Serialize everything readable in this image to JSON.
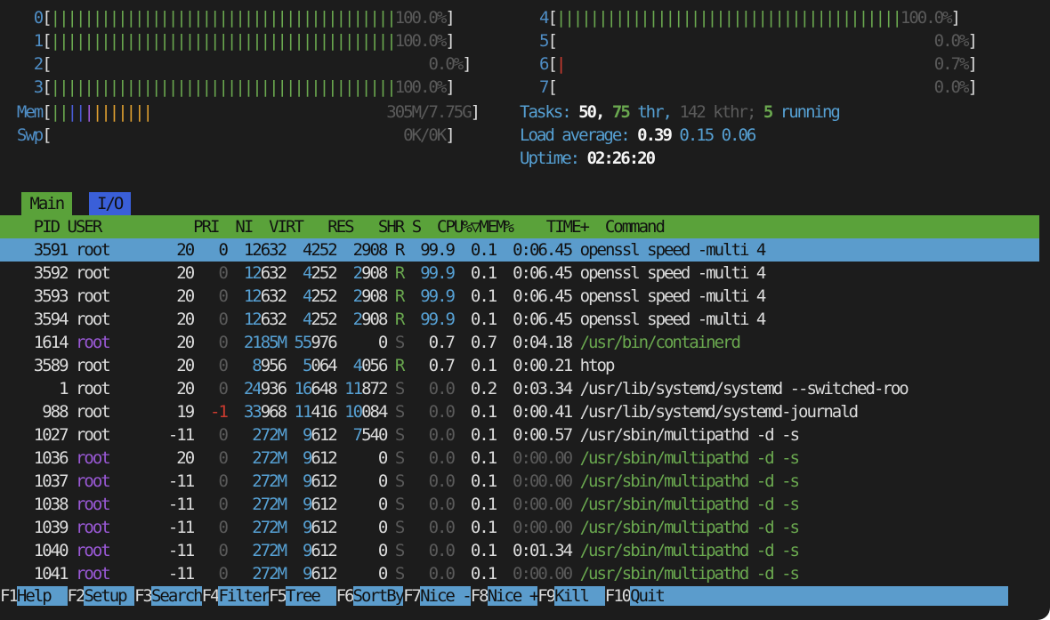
{
  "cpu_meters": [
    {
      "id": "0",
      "pct": "100.0%",
      "level": 1.0
    },
    {
      "id": "1",
      "pct": "100.0%",
      "level": 1.0
    },
    {
      "id": "2",
      "pct": "0.0%",
      "level": 0.0
    },
    {
      "id": "3",
      "pct": "100.0%",
      "level": 1.0
    },
    {
      "id": "4",
      "pct": "100.0%",
      "level": 1.0
    },
    {
      "id": "5",
      "pct": "0.0%",
      "level": 0.0
    },
    {
      "id": "6",
      "pct": "0.7%",
      "level": 0.007
    },
    {
      "id": "7",
      "pct": "0.0%",
      "level": 0.0
    }
  ],
  "mem": {
    "label": "Mem",
    "value": "305M/7.75G"
  },
  "swp": {
    "label": "Swp",
    "value": "0K/0K"
  },
  "tasks": {
    "label": "Tasks:",
    "count": "50,",
    "thr": "75",
    "thr_label": "thr,",
    "kthr": "142 kthr;",
    "running": "5",
    "running_label": "running"
  },
  "load": {
    "label": "Load average:",
    "one": "0.39",
    "five": "0.15",
    "fifteen": "0.06"
  },
  "uptime": {
    "label": "Uptime:",
    "value": "02:26:20"
  },
  "tabs": {
    "main": "Main",
    "io": "I/O"
  },
  "columns": {
    "pid": "PID",
    "user": "USER",
    "pri": "PRI",
    "ni": "NI",
    "virt": "VIRT",
    "res": "RES",
    "shr": "SHR",
    "s": "S",
    "cpu": "CPU%▽",
    "mem": "MEM%",
    "time": "TIME+",
    "command": "Command"
  },
  "processes": [
    {
      "pid": "3591",
      "user": "root",
      "pri": "20",
      "ni": "0",
      "virt": "12632",
      "res": "4252",
      "shr": "2908",
      "s": "R",
      "cpu": "99.9",
      "mem": "0.1",
      "time": "0:06.45",
      "cmd": "openssl speed -multi 4"
    },
    {
      "pid": "3592",
      "user": "root",
      "pri": "20",
      "ni": "0",
      "virt": "12632",
      "res": "4252",
      "shr": "2908",
      "s": "R",
      "cpu": "99.9",
      "mem": "0.1",
      "time": "0:06.45",
      "cmd": "openssl speed -multi 4"
    },
    {
      "pid": "3593",
      "user": "root",
      "pri": "20",
      "ni": "0",
      "virt": "12632",
      "res": "4252",
      "shr": "2908",
      "s": "R",
      "cpu": "99.9",
      "mem": "0.1",
      "time": "0:06.45",
      "cmd": "openssl speed -multi 4"
    },
    {
      "pid": "3594",
      "user": "root",
      "pri": "20",
      "ni": "0",
      "virt": "12632",
      "res": "4252",
      "shr": "2908",
      "s": "R",
      "cpu": "99.9",
      "mem": "0.1",
      "time": "0:06.45",
      "cmd": "openssl speed -multi 4"
    },
    {
      "pid": "1614",
      "user": "root",
      "pri": "20",
      "ni": "0",
      "virt": "2185M",
      "res": "55976",
      "shr": "0",
      "s": "S",
      "cpu": "0.7",
      "mem": "0.7",
      "time": "0:04.18",
      "cmd": "/usr/bin/containerd"
    },
    {
      "pid": "3589",
      "user": "root",
      "pri": "20",
      "ni": "0",
      "virt": "8956",
      "res": "5064",
      "shr": "4056",
      "s": "R",
      "cpu": "0.7",
      "mem": "0.1",
      "time": "0:00.21",
      "cmd": "htop"
    },
    {
      "pid": "1",
      "user": "root",
      "pri": "20",
      "ni": "0",
      "virt": "24936",
      "res": "16648",
      "shr": "11872",
      "s": "S",
      "cpu": "0.0",
      "mem": "0.2",
      "time": "0:03.34",
      "cmd": "/usr/lib/systemd/systemd --switched-roo"
    },
    {
      "pid": "988",
      "user": "root",
      "pri": "19",
      "ni": "-1",
      "virt": "33968",
      "res": "11416",
      "shr": "10084",
      "s": "S",
      "cpu": "0.0",
      "mem": "0.1",
      "time": "0:00.41",
      "cmd": "/usr/lib/systemd/systemd-journald"
    },
    {
      "pid": "1027",
      "user": "root",
      "pri": "-11",
      "ni": "0",
      "virt": "272M",
      "res": "9612",
      "shr": "7540",
      "s": "S",
      "cpu": "0.0",
      "mem": "0.1",
      "time": "0:00.57",
      "cmd": "/usr/sbin/multipathd -d -s"
    },
    {
      "pid": "1036",
      "user": "root",
      "pri": "20",
      "ni": "0",
      "virt": "272M",
      "res": "9612",
      "shr": "0",
      "s": "S",
      "cpu": "0.0",
      "mem": "0.1",
      "time": "0:00.00",
      "cmd": "/usr/sbin/multipathd -d -s"
    },
    {
      "pid": "1037",
      "user": "root",
      "pri": "-11",
      "ni": "0",
      "virt": "272M",
      "res": "9612",
      "shr": "0",
      "s": "S",
      "cpu": "0.0",
      "mem": "0.1",
      "time": "0:00.00",
      "cmd": "/usr/sbin/multipathd -d -s"
    },
    {
      "pid": "1038",
      "user": "root",
      "pri": "-11",
      "ni": "0",
      "virt": "272M",
      "res": "9612",
      "shr": "0",
      "s": "S",
      "cpu": "0.0",
      "mem": "0.1",
      "time": "0:00.00",
      "cmd": "/usr/sbin/multipathd -d -s"
    },
    {
      "pid": "1039",
      "user": "root",
      "pri": "-11",
      "ni": "0",
      "virt": "272M",
      "res": "9612",
      "shr": "0",
      "s": "S",
      "cpu": "0.0",
      "mem": "0.1",
      "time": "0:00.00",
      "cmd": "/usr/sbin/multipathd -d -s"
    },
    {
      "pid": "1040",
      "user": "root",
      "pri": "-11",
      "ni": "0",
      "virt": "272M",
      "res": "9612",
      "shr": "0",
      "s": "S",
      "cpu": "0.0",
      "mem": "0.1",
      "time": "0:01.34",
      "cmd": "/usr/sbin/multipathd -d -s"
    },
    {
      "pid": "1041",
      "user": "root",
      "pri": "-11",
      "ni": "0",
      "virt": "272M",
      "res": "9612",
      "shr": "0",
      "s": "S",
      "cpu": "0.0",
      "mem": "0.1",
      "time": "0:00.00",
      "cmd": "/usr/sbin/multipathd -d -s"
    }
  ],
  "fkeys": [
    {
      "key": "F1",
      "label": "Help"
    },
    {
      "key": "F2",
      "label": "Setup"
    },
    {
      "key": "F3",
      "label": "Search"
    },
    {
      "key": "F4",
      "label": "Filter"
    },
    {
      "key": "F5",
      "label": "Tree"
    },
    {
      "key": "F6",
      "label": "SortBy"
    },
    {
      "key": "F7",
      "label": "Nice -"
    },
    {
      "key": "F8",
      "label": "Nice +"
    },
    {
      "key": "F9",
      "label": "Kill"
    },
    {
      "key": "F10",
      "label": "Quit"
    }
  ],
  "colors": {
    "background": "#1c1c1c",
    "header_bg": "#5aa23a",
    "selection_bg": "#5b9ccc",
    "io_tab_bg": "#3a5fd8",
    "meter_green": "#6aa84f",
    "user_purple": "#9a59d6"
  }
}
